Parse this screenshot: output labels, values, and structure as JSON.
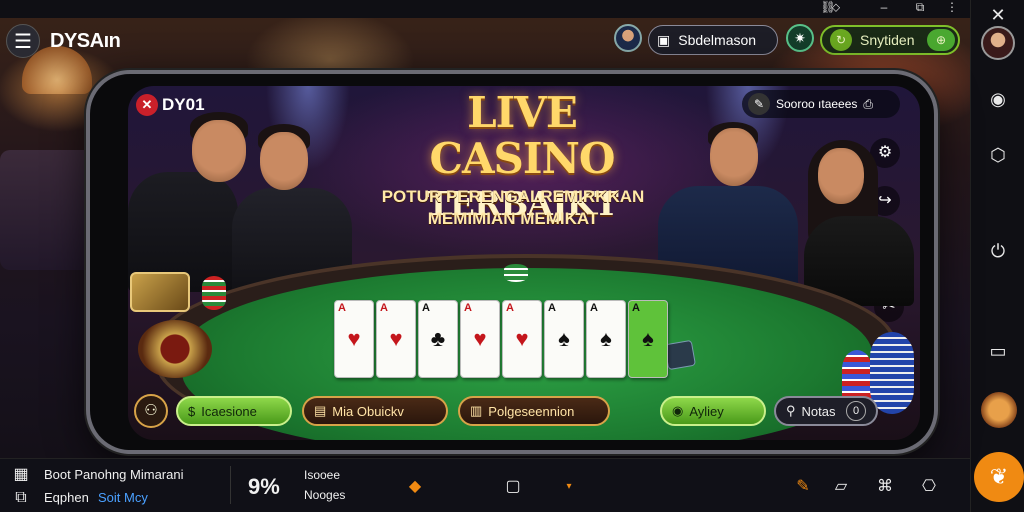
{
  "app": {
    "title": "DYSAın"
  },
  "header": {
    "search_pill_label": "Sbdelmason",
    "action_pill_label": "Snytiden"
  },
  "screen": {
    "brand": "DY01",
    "headline_1": "LIVE CASINO",
    "headline_2": "TERBAJKT",
    "subline_1": "POTUR PERENGALREMIRKKAN",
    "subline_2": "MEMIMIAN MEMIKAT",
    "sound_label": "Sooroo ıtaeees",
    "buttons": {
      "b1": "Icaesione",
      "b2": "Mia Obuickv",
      "b3": "Polgeseennion",
      "b4": "Ayliey",
      "b5": "Notas"
    },
    "cards": [
      {
        "rank": "A",
        "suit": "♥",
        "color": "red"
      },
      {
        "rank": "A",
        "suit": "♥",
        "color": "red"
      },
      {
        "rank": "A",
        "suit": "♣",
        "color": "blk"
      },
      {
        "rank": "A",
        "suit": "♥",
        "color": "red"
      },
      {
        "rank": "A",
        "suit": "♥",
        "color": "red"
      },
      {
        "rank": "A",
        "suit": "♠",
        "color": "blk"
      },
      {
        "rank": "A",
        "suit": "♠",
        "color": "blk"
      },
      {
        "rank": "A",
        "suit": "♠",
        "color": "blk"
      }
    ]
  },
  "bottom": {
    "line1": "Boot Panohng Mimarani",
    "line2a": "Eqphen",
    "line2b": "Soit Mcy",
    "big_number": "9%",
    "stat1": "Isooee",
    "stat2": "Nooges"
  },
  "colors": {
    "accent_green": "#7fbf2a",
    "accent_orange": "#f08a12",
    "felt": "#1c7a30",
    "gold": "#ffd86a"
  }
}
